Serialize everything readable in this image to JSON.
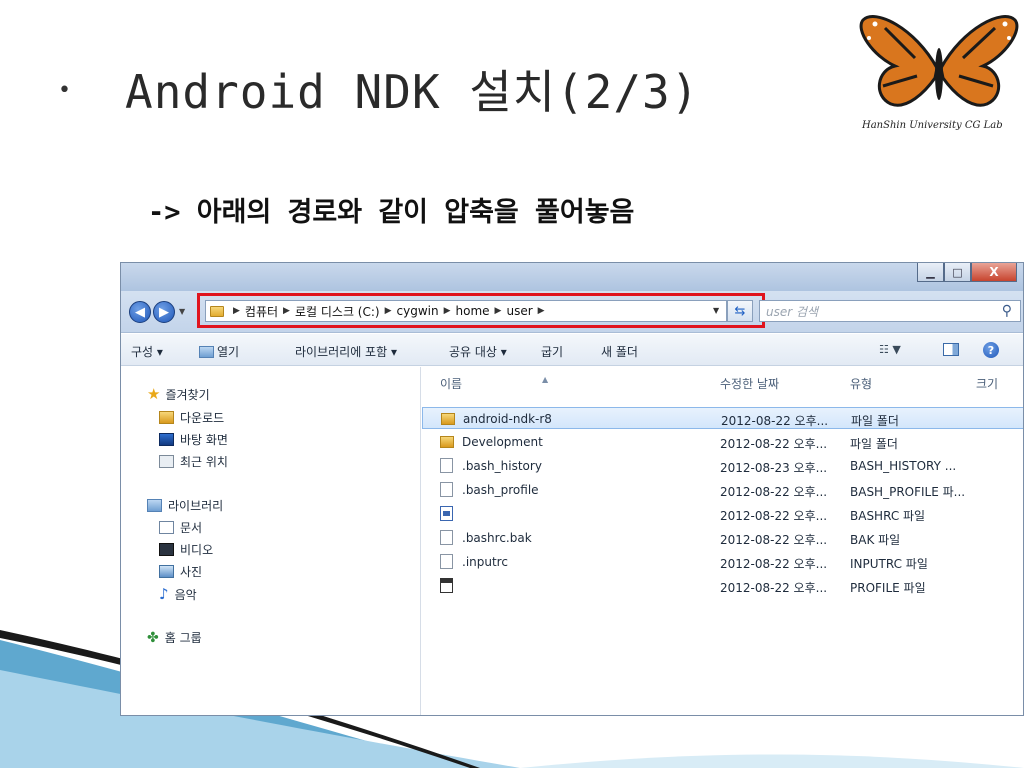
{
  "slide": {
    "bullet": "•",
    "title": "Android NDK 설치(2/3)",
    "subtitle": "-> 아래의 경로와 같이 압축을 풀어놓음",
    "logo_text": "HanShin University CG Lab"
  },
  "explorer": {
    "window_buttons": {
      "minimize": "▁",
      "maximize": "□",
      "close": "X"
    },
    "breadcrumbs": [
      "컴퓨터",
      "로컬 디스크 (C:)",
      "cygwin",
      "home",
      "user"
    ],
    "search_placeholder": "user 검색",
    "toolbar": {
      "organize": "구성 ▾",
      "open": "열기",
      "include_library": "라이브러리에 포함 ▾",
      "share": "공유 대상 ▾",
      "burn": "굽기",
      "new_folder": "새 폴더"
    },
    "nav": {
      "favorites": "즐겨찾기",
      "downloads": "다운로드",
      "desktop": "바탕 화면",
      "recent": "최근 위치",
      "libraries": "라이브러리",
      "documents": "문서",
      "videos": "비디오",
      "pictures": "사진",
      "music": "음악",
      "homegroup": "홈 그룹"
    },
    "columns": {
      "name": "이름",
      "modified": "수정한 날짜",
      "type": "유형",
      "size": "크기"
    },
    "files": [
      {
        "name": "android-ndk-r8",
        "date": "2012-08-22 오후...",
        "type": "파일 폴더",
        "icon": "folder-icon",
        "selected": true
      },
      {
        "name": "Development",
        "date": "2012-08-22 오후...",
        "type": "파일 폴더",
        "icon": "folder-icon",
        "selected": false
      },
      {
        "name": ".bash_history",
        "date": "2012-08-23 오후...",
        "type": "BASH_HISTORY ...",
        "icon": "file-icon",
        "selected": false
      },
      {
        "name": ".bash_profile",
        "date": "2012-08-22 오후...",
        "type": "BASH_PROFILE 파...",
        "icon": "file-icon",
        "selected": false
      },
      {
        "name": "",
        "date": "2012-08-22 오후...",
        "type": "BASHRC 파일",
        "icon": "document-icon",
        "selected": false
      },
      {
        "name": ".bashrc.bak",
        "date": "2012-08-22 오후...",
        "type": "BAK 파일",
        "icon": "file-icon",
        "selected": false
      },
      {
        "name": ".inputrc",
        "date": "2012-08-22 오후...",
        "type": "INPUTRC 파일",
        "icon": "file-icon",
        "selected": false
      },
      {
        "name": "",
        "date": "2012-08-22 오후...",
        "type": "PROFILE 파일",
        "icon": "calendar-icon",
        "selected": false
      }
    ]
  },
  "colors": {
    "highlight_outline": "#e0141e",
    "selection": "#d3e6fb",
    "accent": "#1f57b8"
  }
}
